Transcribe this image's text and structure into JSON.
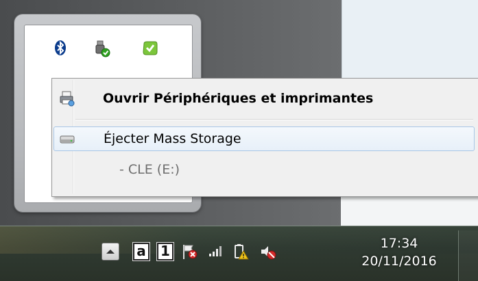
{
  "context_menu": {
    "open_devices_label": "Ouvrir Périphériques et imprimantes",
    "eject_label": "Éjecter Mass Storage",
    "drive_label": "- CLE (E:)"
  },
  "tray_popup": {
    "icons": [
      "bluetooth-icon",
      "usb-safely-remove-icon",
      "skype-icon"
    ]
  },
  "taskbar": {
    "language_indicator": "a",
    "number_indicator": "1",
    "clock_time": "17:34",
    "clock_date": "20/11/2016",
    "icons": [
      "show-hidden-icons",
      "action-center-flag-icon",
      "network-signal-icon",
      "battery-warning-icon",
      "volume-muted-icon"
    ]
  },
  "colors": {
    "menu_highlight_border": "#a8c6e6",
    "menu_background": "#f0f0f0",
    "taskbar": "#2f3a31"
  }
}
